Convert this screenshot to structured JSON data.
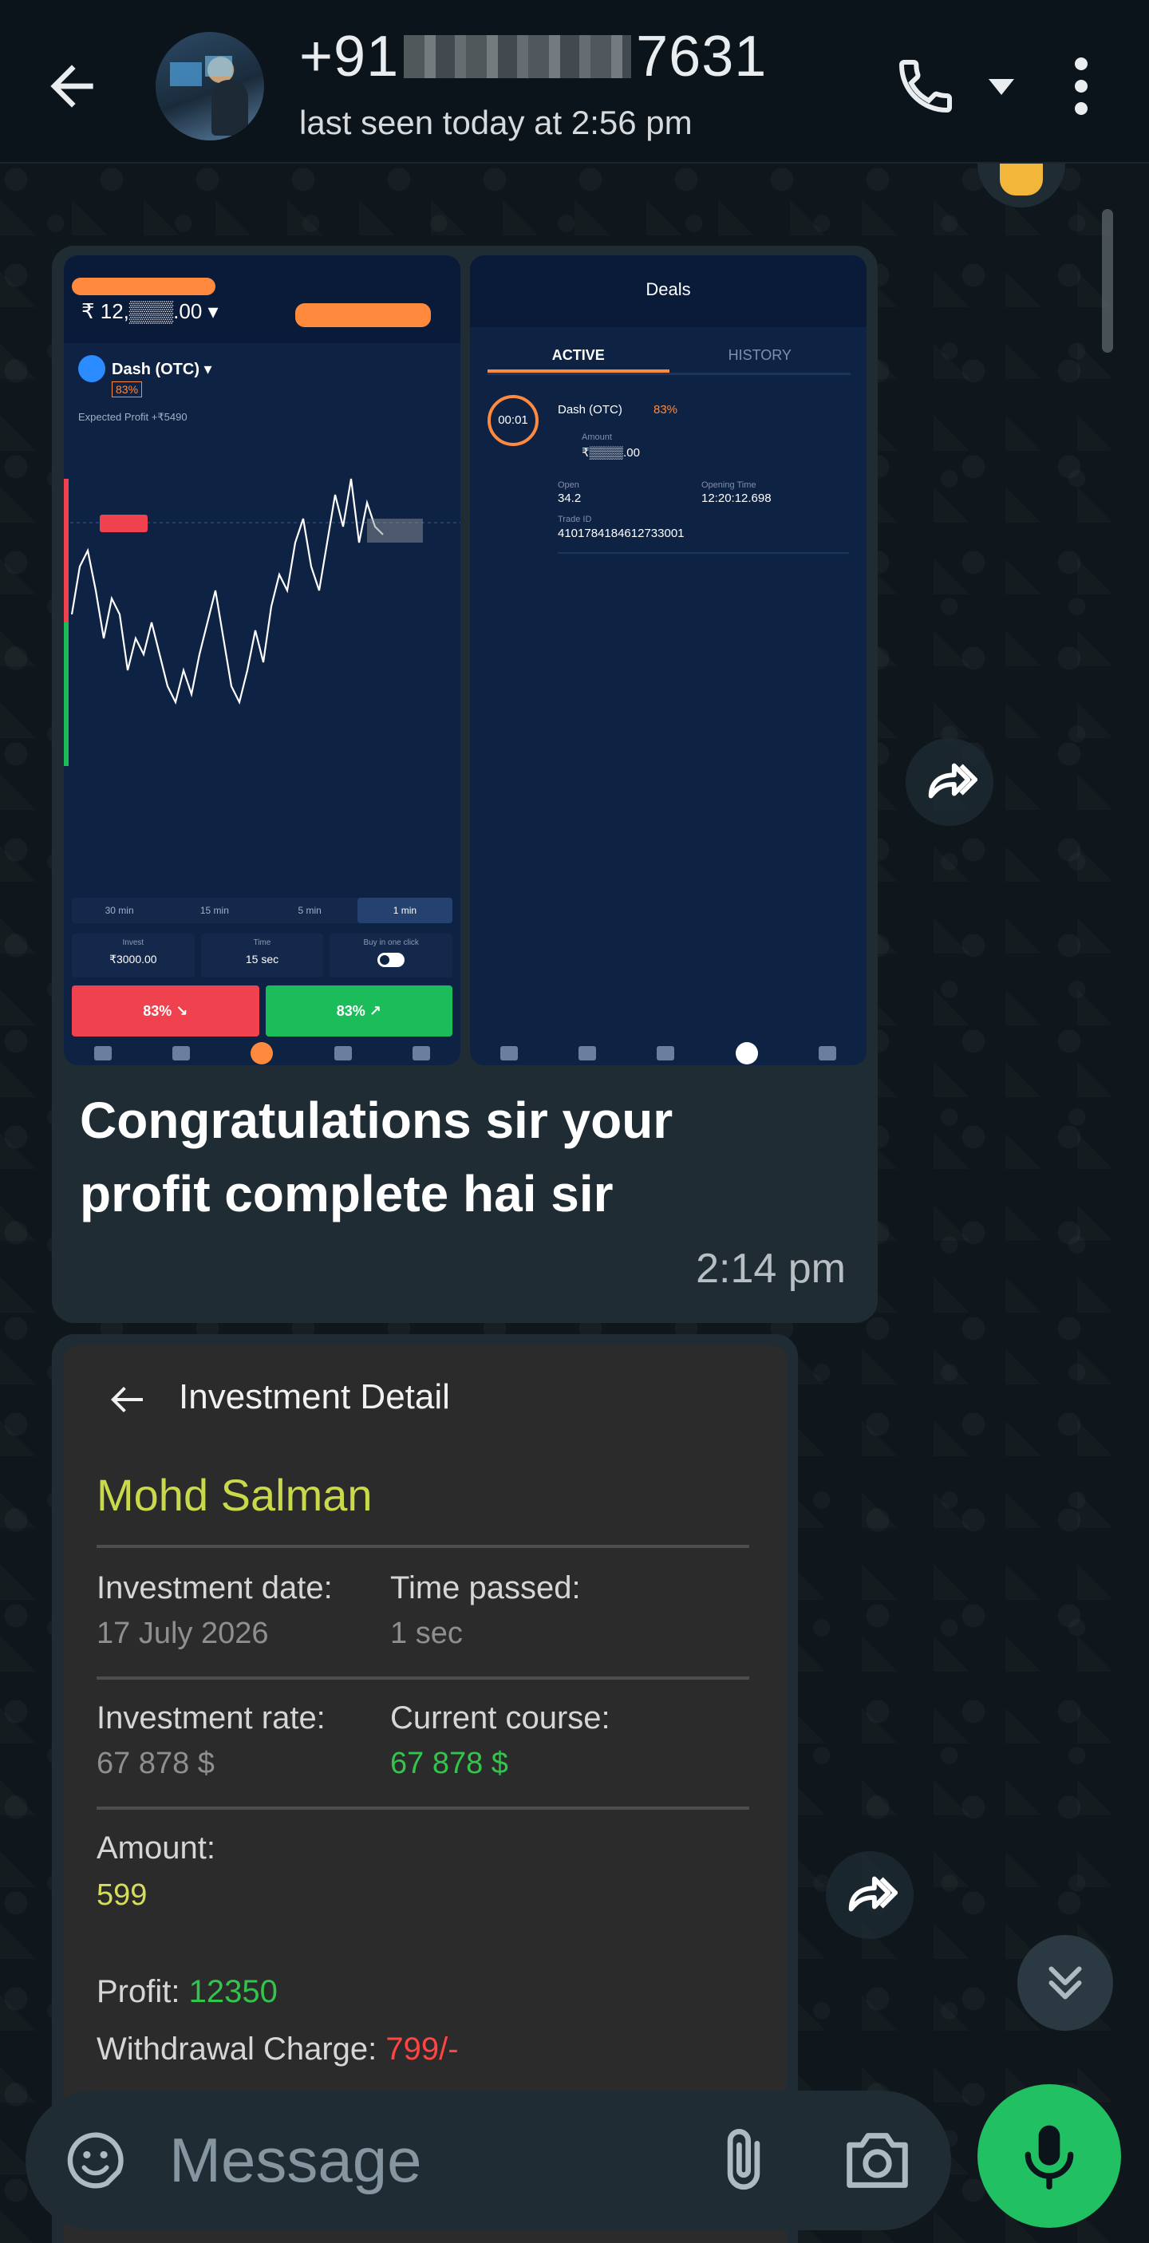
{
  "header": {
    "contact_prefix": "+91",
    "contact_suffix": "7631",
    "last_seen": "last seen today at 2:56 pm"
  },
  "message1": {
    "screenshot_left": {
      "balance": "₹ 12,▒▒▒.00 ▾",
      "asset": "Dash (OTC) ▾",
      "asset_pct": "83%",
      "expected_profit": "Expected Profit +₹5490",
      "timeframes": [
        "30 min",
        "15 min",
        "5 min",
        "1 min"
      ],
      "invest_label": "Invest",
      "invest_value": "₹3000.00",
      "time_label": "Time",
      "time_value": "15 sec",
      "buy_one_click": "Buy in one click",
      "sell_label": "83% ↘",
      "buy_label": "83% ↗"
    },
    "screenshot_right": {
      "title": "Deals",
      "tab_active": "ACTIVE",
      "tab_history": "HISTORY",
      "timer": "00:01",
      "asset": "Dash (OTC)",
      "asset_pct": "83%",
      "amount_label": "Amount",
      "amount": "₹▒▒▒▒.00",
      "open_label": "Open",
      "open_value": "34.2",
      "opening_time_label": "Opening Time",
      "opening_time": "12:20:12.698",
      "trade_id_label": "Trade ID",
      "trade_id": "4101784184612733001"
    },
    "caption": "Congratulations sir your profit complete hai sir",
    "time": "2:14 pm"
  },
  "message2": {
    "title": "Investment Detail",
    "name": "Mohd Salman",
    "investment_date_label": "Investment date:",
    "investment_date": "17 July 2026",
    "time_passed_label": "Time passed:",
    "time_passed": "1 sec",
    "investment_rate_label": "Investment rate:",
    "investment_rate": "67 878 $",
    "current_course_label": "Current course:",
    "current_course": "67 878 $",
    "amount_label": "Amount:",
    "amount": "599",
    "profit_label": "Profit:",
    "profit": "12350",
    "withdrawal_label": "Withdrawal Charge:",
    "withdrawal": "799/-"
  },
  "input": {
    "placeholder": "Message"
  },
  "colors": {
    "accent_green": "#21c063",
    "bubble": "#1f2c34",
    "background": "#0b141a"
  }
}
